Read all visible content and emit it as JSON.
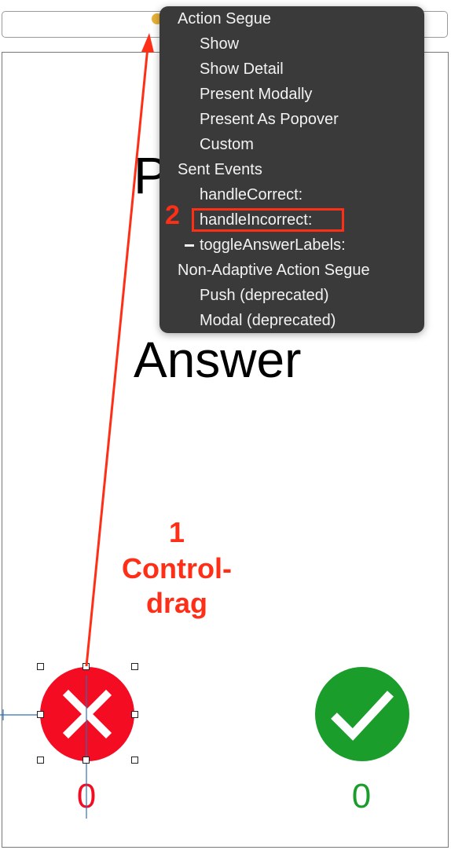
{
  "canvas": {
    "prompt_label": "Prompt",
    "answer_label": "Answer",
    "incorrect_count": "0",
    "correct_count": "0",
    "incorrect_button_icon": "x-icon",
    "correct_button_icon": "checkmark-icon"
  },
  "menu": {
    "sections": [
      {
        "title": "Action Segue",
        "items": [
          "Show",
          "Show Detail",
          "Present Modally",
          "Present As Popover",
          "Custom"
        ]
      },
      {
        "title": "Sent Events",
        "items": [
          "handleCorrect:",
          "handleIncorrect:",
          "toggleAnswerLabels:"
        ]
      },
      {
        "title": "Non-Adaptive Action Segue",
        "items": [
          "Push (deprecated)",
          "Modal (deprecated)"
        ]
      }
    ]
  },
  "annotations": {
    "step1_number": "1",
    "step1_line1": "Control-",
    "step1_line2": "drag",
    "step2_number": "2"
  },
  "colors": {
    "incorrect": "#f30c22",
    "correct": "#1a9d2b",
    "annotation": "#ff2e17",
    "menu_bg": "#3a3a3a",
    "connector": "#e8b235"
  }
}
